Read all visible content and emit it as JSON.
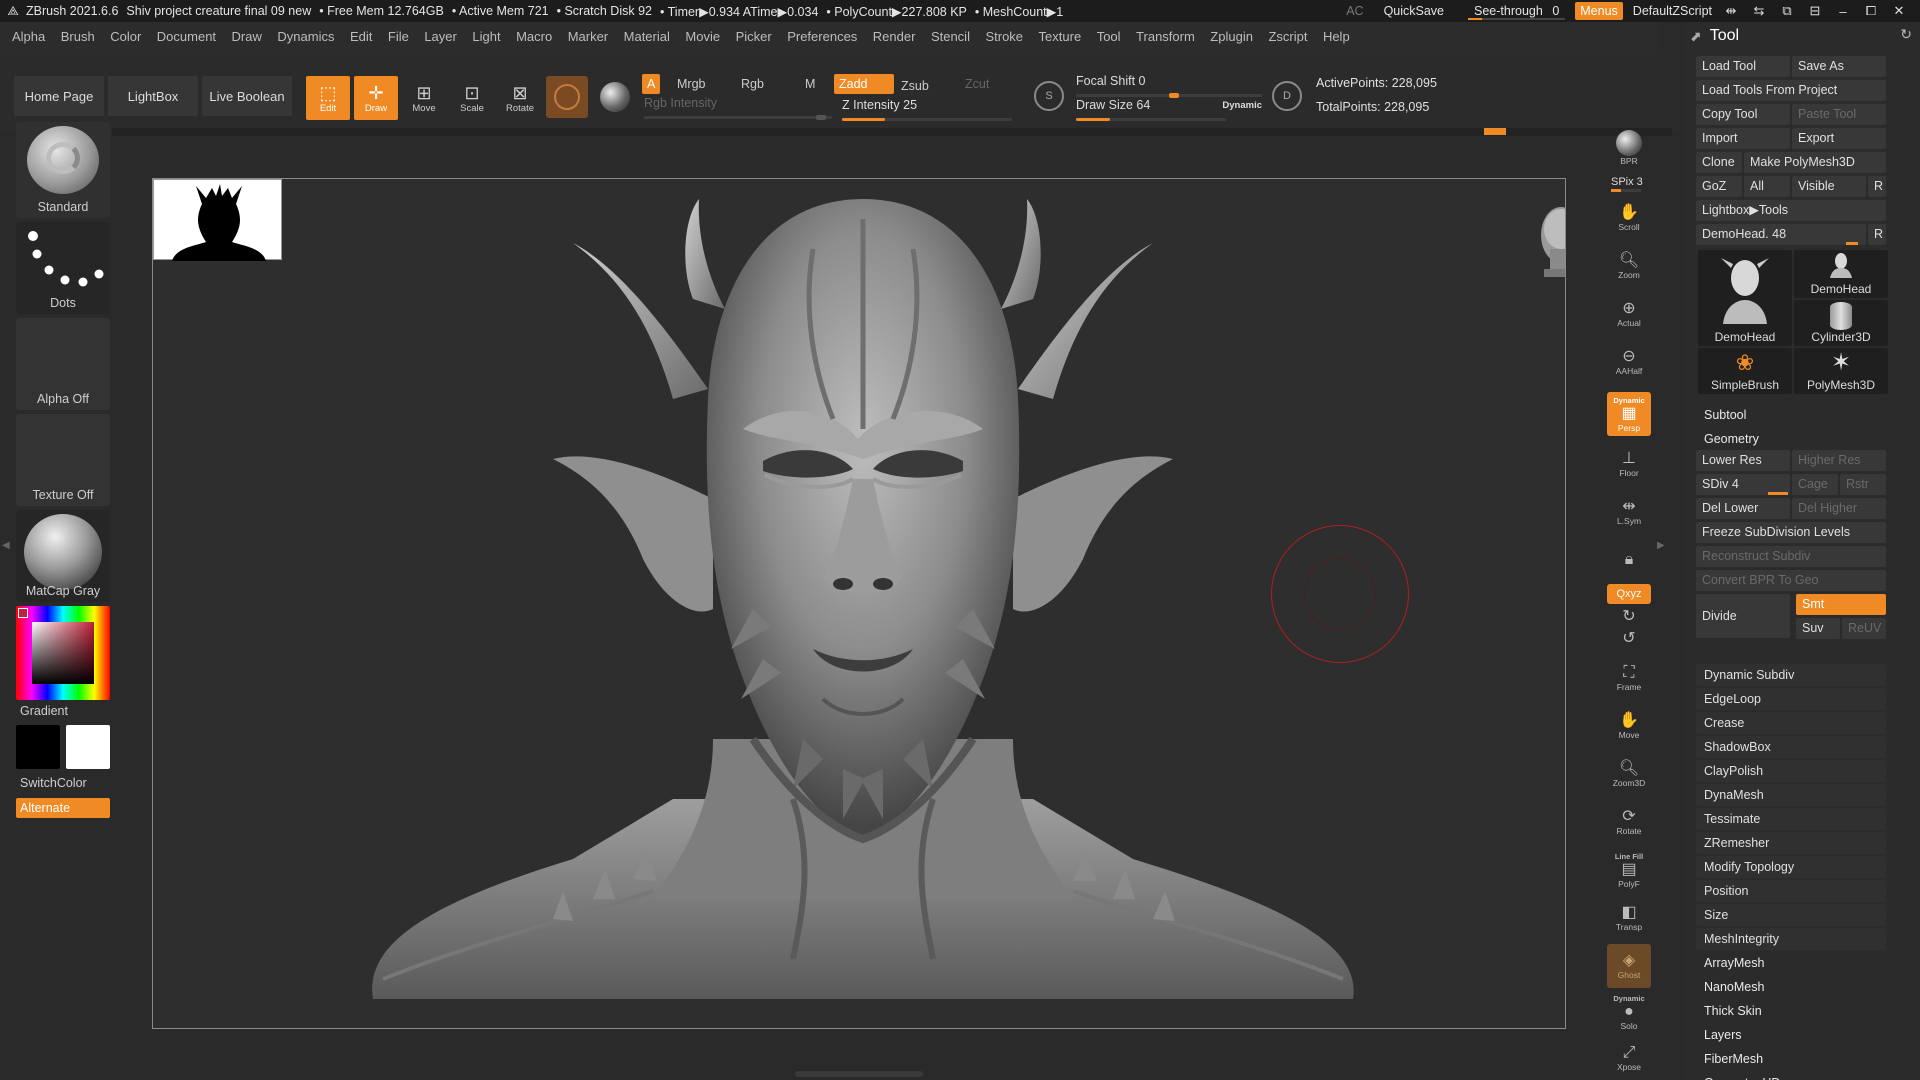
{
  "titlebar": {
    "app": "ZBrush 2021.6.6",
    "project": "Shiv project creature final 09 new",
    "free_mem": "• Free Mem 12.764GB",
    "active_mem": "• Active Mem 721",
    "scratch": "• Scratch Disk 92",
    "timer": "• Timer▶0.934 ATime▶0.034",
    "polycount": "• PolyCount▶227.808 KP",
    "meshcount": "• MeshCount▶1",
    "ac": "AC",
    "quicksave": "QuickSave",
    "see_through": "See-through",
    "see_through_value": "0",
    "menus": "Menus",
    "script": "DefaultZScript"
  },
  "menubar": [
    "Alpha",
    "Brush",
    "Color",
    "Document",
    "Draw",
    "Dynamics",
    "Edit",
    "File",
    "Layer",
    "Light",
    "Macro",
    "Marker",
    "Material",
    "Movie",
    "Picker",
    "Preferences",
    "Render",
    "Stencil",
    "Stroke",
    "Texture",
    "Tool",
    "Transform",
    "Zplugin",
    "Zscript",
    "Help"
  ],
  "shelf": {
    "home_page": "Home Page",
    "lightbox": "LightBox",
    "live_boolean": "Live Boolean",
    "edit": "Edit",
    "draw": "Draw",
    "move": "Move",
    "scale": "Scale",
    "rotate": "Rotate",
    "a": "A",
    "mrgb": "Mrgb",
    "rgb": "Rgb",
    "m": "M",
    "zadd": "Zadd",
    "zsub": "Zsub",
    "zcut": "Zcut",
    "rgb_intensity": "Rgb Intensity",
    "z_intensity": "Z Intensity 25",
    "focal_shift": "Focal Shift 0",
    "draw_size": "Draw Size 64",
    "dynamic": "Dynamic",
    "active_points": "ActivePoints: 228,095",
    "total_points": "TotalPoints: 228,095",
    "z_intensity_value": 25,
    "draw_size_value": 64,
    "focal_shift_value": 0
  },
  "leftpanel": {
    "standard": "Standard",
    "dots": "Dots",
    "alpha_off": "Alpha Off",
    "texture_off": "Texture Off",
    "matcap": "MatCap Gray",
    "gradient": "Gradient",
    "switchcolor": "SwitchColor",
    "alternate": "Alternate"
  },
  "rightdock": {
    "bpr": "BPR",
    "spix": "SPix 3",
    "scroll": "Scroll",
    "zoom": "Zoom",
    "actual": "Actual",
    "aahalf": "AAHalf",
    "persp": "Persp",
    "dynamic": "Dynamic",
    "floor": "Floor",
    "lsym": "L.Sym",
    "xyz": "Qxyz",
    "frame": "Frame",
    "move": "Move",
    "zoom3d": "Zoom3D",
    "rotate": "Rotate",
    "linefill": "Line Fill",
    "polyf": "PolyF",
    "transp": "Transp",
    "ghost": "Ghost",
    "dynamic2": "Dynamic",
    "solo": "Solo",
    "xpose": "Xpose"
  },
  "toolpanel": {
    "title": "Tool",
    "load_tool": "Load Tool",
    "save_as": "Save As",
    "load_from_project": "Load Tools From Project",
    "copy_tool": "Copy Tool",
    "paste_tool": "Paste Tool",
    "import": "Import",
    "export": "Export",
    "clone": "Clone",
    "make_polymesh": "Make PolyMesh3D",
    "goz": "GoZ",
    "all": "All",
    "visible": "Visible",
    "r": "R",
    "lightbox_tools": "Lightbox▶Tools",
    "demohead_slider": "DemoHead. 48",
    "tiles": [
      "DemoHead",
      "DemoHead",
      "Cylinder3D",
      "SimpleBrush",
      "PolyMesh3D"
    ],
    "subtool": "Subtool",
    "geometry": "Geometry",
    "lower_res": "Lower Res",
    "higher_res": "Higher Res",
    "sdiv": "SDiv 4",
    "cage": "Cage",
    "rstr": "Rstr",
    "del_lower": "Del Lower",
    "del_higher": "Del Higher",
    "freeze": "Freeze SubDivision Levels",
    "reconstruct": "Reconstruct Subdiv",
    "convert_bpr": "Convert BPR To Geo",
    "divide": "Divide",
    "smt": "Smt",
    "suv": "Suv",
    "reuv": "ReUV",
    "geometry_items": [
      "Dynamic Subdiv",
      "EdgeLoop",
      "Crease",
      "ShadowBox",
      "ClayPolish",
      "DynaMesh",
      "Tessimate",
      "ZRemesher",
      "Modify Topology",
      "Position",
      "Size",
      "MeshIntegrity"
    ],
    "sections": [
      "ArrayMesh",
      "NanoMesh",
      "Thick Skin",
      "Layers",
      "FiberMesh",
      "Geometry HD"
    ]
  },
  "colors": {
    "accent": "#f08a24",
    "background": "#2a2a2a",
    "brush_cursor": "#b02020"
  }
}
